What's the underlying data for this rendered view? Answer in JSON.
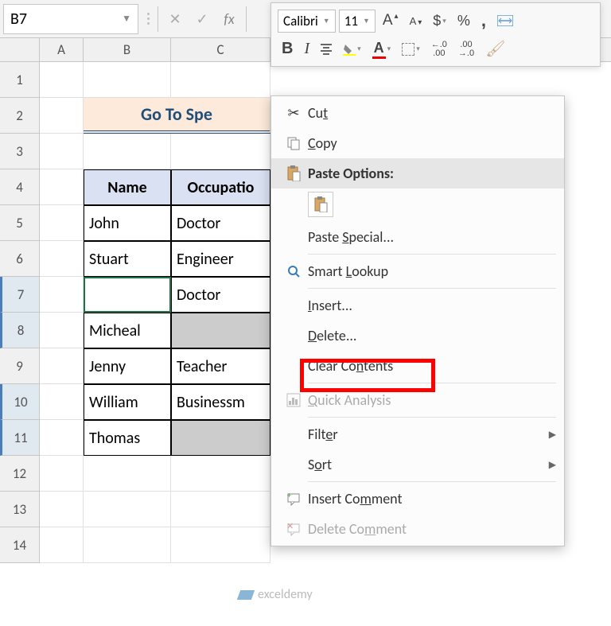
{
  "name_box": "B7",
  "title": "Go To Spe",
  "headers": {
    "name": "Name",
    "occupation": "Occupatio"
  },
  "rows": [
    {
      "name": "John",
      "occupation": "Doctor"
    },
    {
      "name": "Stuart",
      "occupation": "Engineer"
    },
    {
      "name": "",
      "occupation": "Doctor"
    },
    {
      "name": "Micheal",
      "occupation": ""
    },
    {
      "name": "Jenny",
      "occupation": "Teacher"
    },
    {
      "name": "William",
      "occupation": "Businessm"
    },
    {
      "name": "Thomas",
      "occupation": ""
    }
  ],
  "mini": {
    "font": "Calibri",
    "size": "11",
    "currency": "$",
    "percent": "%",
    "comma": ",",
    "bold": "B",
    "italic": "I",
    "fontA": "A",
    "dec1": ".0 .00",
    "dec2": ".00 .0"
  },
  "ctx": {
    "cut": "Cut",
    "copy": "Copy",
    "paste_options": "Paste Options:",
    "paste_special": "Paste Special...",
    "smart_lookup": "Smart Lookup",
    "insert": "Insert...",
    "delete": "Delete...",
    "clear": "Clear Contents",
    "quick": "Quick Analysis",
    "filter": "Filter",
    "sort": "Sort",
    "ins_comment": "Insert Comment",
    "del_comment": "Delete Comment"
  },
  "watermark": "exceldemy",
  "col_labels": {
    "A": "A",
    "B": "B",
    "C": "C"
  },
  "row_labels": [
    "1",
    "2",
    "3",
    "4",
    "5",
    "6",
    "7",
    "8",
    "9",
    "10",
    "11",
    "12",
    "13",
    "14"
  ]
}
